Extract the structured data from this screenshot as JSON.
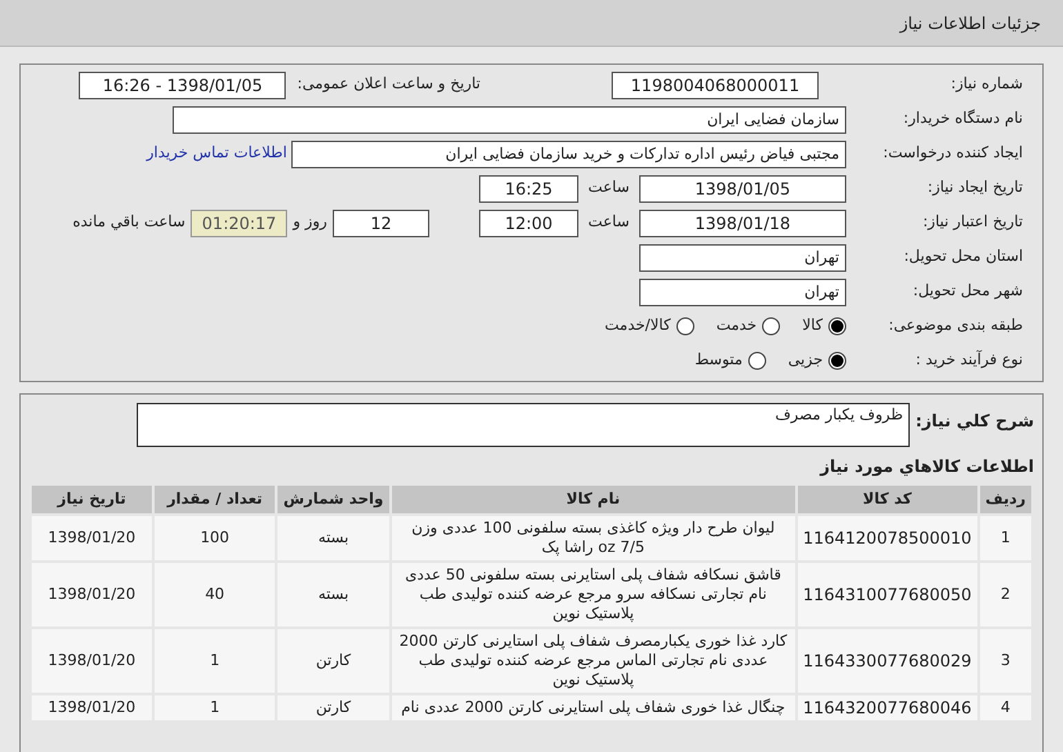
{
  "header": {
    "title": "جزئیات اطلاعات نیاز"
  },
  "need_number": {
    "label": "شماره نیاز:",
    "value": "1198004068000011"
  },
  "announce": {
    "label": "تاریخ و ساعت اعلان عمومی:",
    "value": "1398/01/05 - 16:26"
  },
  "buyer": {
    "label": "نام دستگاه خریدار:",
    "value": "سازمان فضایی ایران"
  },
  "requester": {
    "label": "ایجاد کننده درخواست:",
    "value": "مجتبی  فیاض رئیس اداره تدارکات و خرید سازمان فضایی ایران",
    "link": "اطلاعات تماس خریدار"
  },
  "created": {
    "label": "تاریخ ایجاد نیاز:",
    "date": "1398/01/05",
    "time_label": "ساعت",
    "time": "16:25"
  },
  "validity": {
    "label": "تاریخ اعتبار نیاز:",
    "date": "1398/01/18",
    "time_label": "ساعت",
    "time": "12:00",
    "days": "12",
    "days_label": "روز و",
    "remaining": "01:20:17",
    "remaining_label": "ساعت باقي مانده"
  },
  "province": {
    "label": "استان محل تحویل:",
    "value": "تهران"
  },
  "city": {
    "label": "شهر محل تحویل:",
    "value": "تهران"
  },
  "category": {
    "label": "طبقه بندی موضوعی:",
    "options": [
      {
        "label": "کالا",
        "selected": true
      },
      {
        "label": "خدمت",
        "selected": false
      },
      {
        "label": "کالا/خدمت",
        "selected": false
      }
    ]
  },
  "process": {
    "label": "نوع فرآیند خرید :",
    "options": [
      {
        "label": "جزیی",
        "selected": true
      },
      {
        "label": "متوسط",
        "selected": false
      }
    ]
  },
  "description": {
    "label": "شرح کلي نياز:",
    "value": "ظروف یکبار مصرف"
  },
  "items": {
    "title": "اطلاعات کالاهاي مورد نياز",
    "columns": [
      "ردیف",
      "کد کالا",
      "نام کالا",
      "واحد شمارش",
      "تعداد / مقدار",
      "تاریخ نیاز"
    ],
    "rows": [
      [
        "1",
        "1164120078500010",
        "لیوان طرح دار ویژه کاغذی بسته سلفونی 100 عددی وزن 7/5 oz راشا پک",
        "بسته",
        "100",
        "1398/01/20"
      ],
      [
        "2",
        "1164310077680050",
        "قاشق نسکافه شفاف پلی استایرنی بسته سلفونی 50 عددی نام تجارتی نسکافه سرو مرجع عرضه کننده تولیدی طب پلاستیک نوین",
        "بسته",
        "40",
        "1398/01/20"
      ],
      [
        "3",
        "1164330077680029",
        "کارد غذا خوری یکبارمصرف شفاف پلی استایرنی کارتن 2000 عددی نام تجارتی الماس مرجع عرضه کننده تولیدی طب پلاستیک نوین",
        "کارتن",
        "1",
        "1398/01/20"
      ],
      [
        "4",
        "1164320077680046",
        "چنگال غذا خوری شفاف پلی استایرنی کارتن 2000 عددی نام",
        "کارتن",
        "1",
        "1398/01/20"
      ]
    ]
  }
}
